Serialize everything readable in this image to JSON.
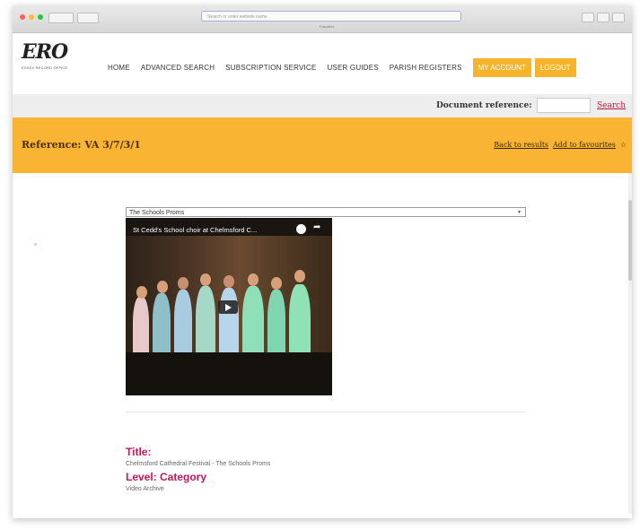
{
  "browser": {
    "url": "Search or enter website name",
    "tab": "Favorites",
    "colors": {
      "close": "#ff5f57",
      "minimize": "#febc2e",
      "zoom": "#28c840"
    }
  },
  "logo": {
    "text": "ERO",
    "subtitle": "ESSEX RECORD OFFICE"
  },
  "nav": {
    "items": [
      "HOME",
      "ADVANCED SEARCH",
      "SUBSCRIPTION SERVICE",
      "USER GUIDES",
      "PARISH REGISTERS"
    ],
    "my_account": "MY ACCOUNT",
    "logout": "LOGOUT",
    "accent": "#f6b42d"
  },
  "doc_ref": {
    "label": "Document reference:",
    "value": "",
    "search": "Search"
  },
  "reference": {
    "text": "Reference: VA 3/7/3/1",
    "back": "Back to results",
    "favourites": "Add to favourites",
    "favourite_icon": "star-icon"
  },
  "media": {
    "selected": "The Schools Proms",
    "video_title": "St Cedd's School choir at Chelmsford C...",
    "watch_later_icon": "clock-icon",
    "share_icon": "share-icon",
    "play_icon": "play-icon"
  },
  "details": {
    "title_label": "Title:",
    "title_value": "Chelmsford Cathedral Festival - The Schools Proms",
    "level_label": "Level: Category",
    "level_value": "Video Archive"
  }
}
